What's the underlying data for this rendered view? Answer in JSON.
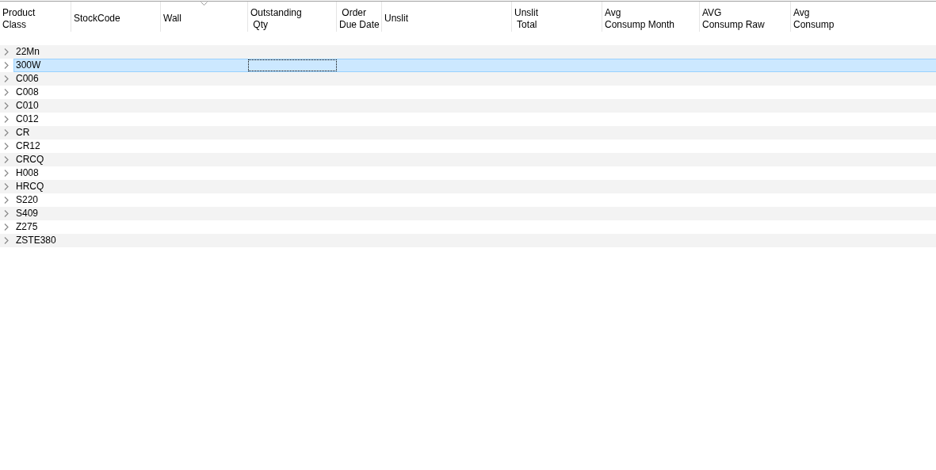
{
  "table": {
    "columns": [
      {
        "lines": [
          "Product",
          "Class"
        ],
        "sorted": false
      },
      {
        "lines": [
          "StockCode"
        ],
        "sorted": false
      },
      {
        "lines": [
          "Wall"
        ],
        "sorted": true
      },
      {
        "lines": [
          "Outstanding",
          " Qty"
        ],
        "sorted": false,
        "focused": true
      },
      {
        "lines": [
          " Order",
          "Due Date"
        ],
        "sorted": false
      },
      {
        "lines": [
          "Unslit"
        ],
        "sorted": false
      },
      {
        "lines": [
          "Unslit",
          " Total"
        ],
        "sorted": false
      },
      {
        "lines": [
          "Avg",
          "Consump Month"
        ],
        "sorted": false
      },
      {
        "lines": [
          "AVG",
          "Consump Raw"
        ],
        "sorted": false
      },
      {
        "lines": [
          "Avg",
          "Consump"
        ],
        "sorted": false
      }
    ],
    "rows": [
      {
        "label": "22Mn",
        "selected": false,
        "expanded": false
      },
      {
        "label": "300W",
        "selected": true,
        "expanded": false
      },
      {
        "label": "C006",
        "selected": false,
        "expanded": false
      },
      {
        "label": "C008",
        "selected": false,
        "expanded": false
      },
      {
        "label": "C010",
        "selected": false,
        "expanded": false
      },
      {
        "label": "C012",
        "selected": false,
        "expanded": false
      },
      {
        "label": "CR",
        "selected": false,
        "expanded": false
      },
      {
        "label": "CR12",
        "selected": false,
        "expanded": false
      },
      {
        "label": "CRCQ",
        "selected": false,
        "expanded": false
      },
      {
        "label": "H008",
        "selected": false,
        "expanded": false
      },
      {
        "label": "HRCQ",
        "selected": false,
        "expanded": false
      },
      {
        "label": "S220",
        "selected": false,
        "expanded": false
      },
      {
        "label": "S409",
        "selected": false,
        "expanded": false
      },
      {
        "label": "Z275",
        "selected": false,
        "expanded": false
      },
      {
        "label": "ZSTE380",
        "selected": false,
        "expanded": false
      }
    ]
  }
}
